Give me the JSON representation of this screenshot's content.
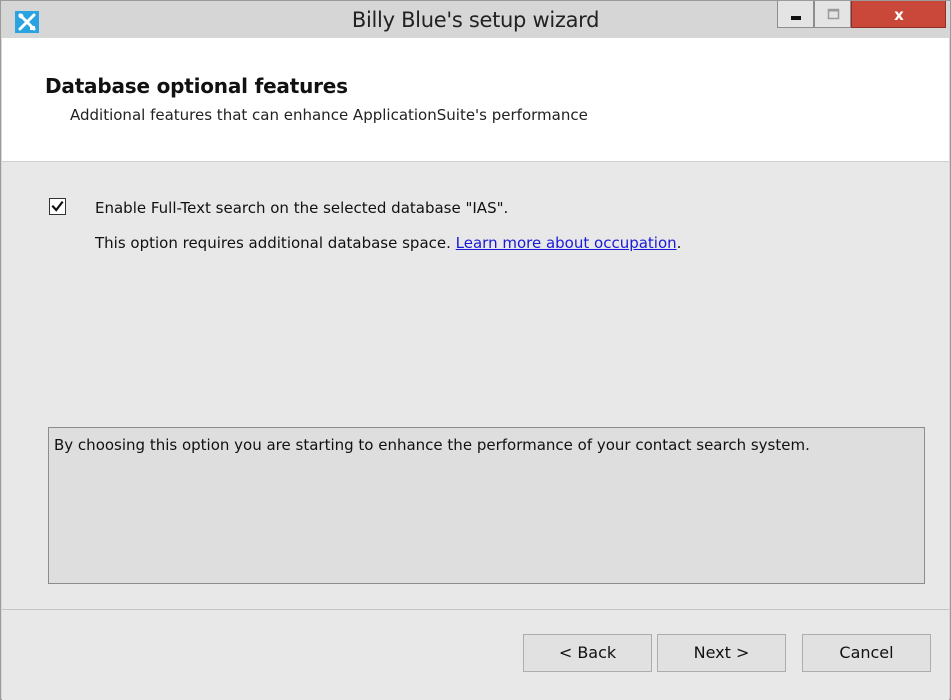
{
  "window": {
    "title": "Billy Blue's setup wizard",
    "app_icon": "tools-icon",
    "controls": {
      "minimize_icon": "minimize-icon",
      "maximize_icon": "maximize-icon",
      "close_icon": "close-icon",
      "close_glyph": "x"
    }
  },
  "header": {
    "title": "Database optional features",
    "subtitle": "Additional features that can enhance ApplicationSuite's performance"
  },
  "option": {
    "checked": true,
    "label": "Enable Full-Text search on the selected database \"IAS\".",
    "note_text": "This option requires additional database space. ",
    "link_text": "Learn more about occupation",
    "note_suffix": "."
  },
  "info_box": {
    "text": "By choosing this option you are starting to enhance the performance of your contact search system."
  },
  "footer": {
    "back_label": "< Back",
    "next_label": "Next >",
    "cancel_label": "Cancel"
  },
  "colors": {
    "titlebar": "#d6d6d6",
    "close_button": "#c9483a",
    "link": "#1a1ad6",
    "app_icon_bg": "#2aa3e0"
  }
}
